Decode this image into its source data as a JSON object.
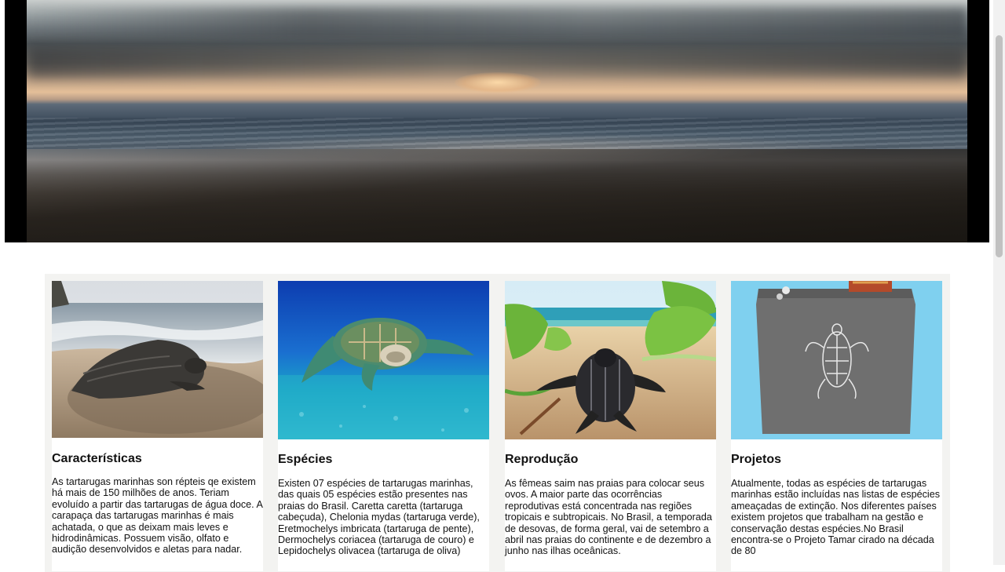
{
  "hero": {
    "image_description": "sunset-over-beach"
  },
  "cards": [
    {
      "title": "Características",
      "text": "As tartarugas marinhas son répteis qe existem há mais de 150 milhões de anos. Teriam evoluído a partir das tartarugas de água doce. A carapaça das tartarugas marinhas é mais achatada, o que as deixam mais leves e hidrodinâmicas. Possuem visão, olfato e audição desenvolvidos e aletas para nadar."
    },
    {
      "title": "Espécies",
      "text": "Existen 07 espécies de tartarugas marinhas, das quais 05 espécies estão presentes nas praias do Brasil. Caretta caretta (tartaruga cabeçuda), Chelonia mydas (tartaruga verde), Eretmochelys imbricata (tartaruga de pente), Dermochelys coriacea (tartaruga de couro) e Lepidochelys olivacea (tartaruga de oliva)"
    },
    {
      "title": "Reprodução",
      "text": "As fêmeas saim nas praias para colocar seus ovos. A maior parte das ocorrências reprodutivas está concentrada nas regiões tropicais e subtropicais. No Brasil, a temporada de desovas, de forma geral, vai de setembro a abril nas praias do continente e de dezembro a junho nas ilhas oceânicas."
    },
    {
      "title": "Projetos",
      "text": "Atualmente, todas as espécies de tartarugas marinhas estão incluídas nas listas de espécies ameaçadas de extinção. Nos diferentes países existem projetos que trabalham na gestão e conservação destas espécies.No Brasil encontra-se o Projeto Tamar cirado na década de 80"
    }
  ],
  "colors": {
    "panel_bg": "#f3f3f1",
    "card_bg": "#ffffff",
    "hero_frame": "#000000"
  }
}
